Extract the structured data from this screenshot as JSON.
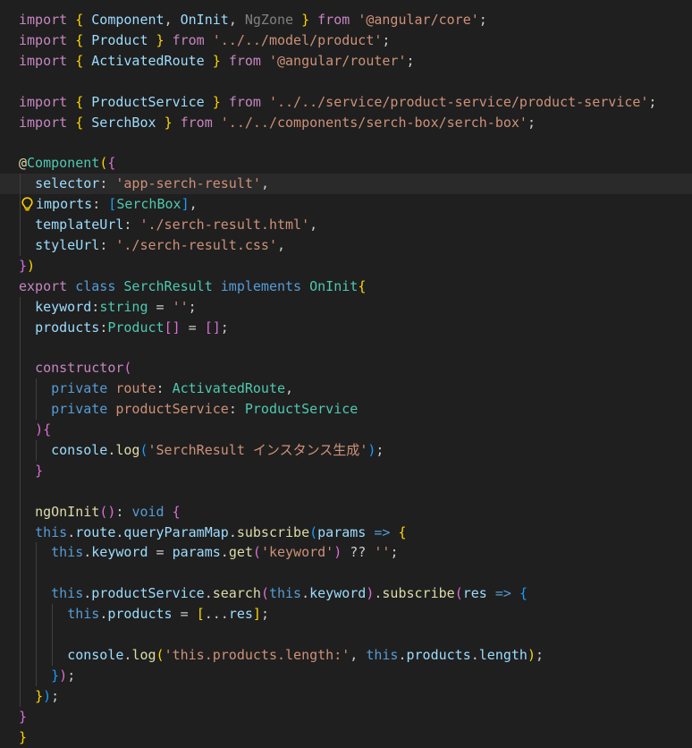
{
  "editor": {
    "lines": [
      [
        [
          "t-kw",
          "import"
        ],
        [
          "t-punc",
          " "
        ],
        [
          "t-b1",
          "{"
        ],
        [
          "t-punc",
          " "
        ],
        [
          "t-id",
          "Component"
        ],
        [
          "t-punc",
          ", "
        ],
        [
          "t-id",
          "OnInit"
        ],
        [
          "t-punc",
          ", "
        ],
        [
          "t-ngzone",
          "NgZone"
        ],
        [
          "t-punc",
          " "
        ],
        [
          "t-b1",
          "}"
        ],
        [
          "t-punc",
          " "
        ],
        [
          "t-kw",
          "from"
        ],
        [
          "t-punc",
          " "
        ],
        [
          "t-str",
          "'@angular/core'"
        ],
        [
          "t-punc",
          ";"
        ]
      ],
      [
        [
          "t-kw",
          "import"
        ],
        [
          "t-punc",
          " "
        ],
        [
          "t-b1",
          "{"
        ],
        [
          "t-punc",
          " "
        ],
        [
          "t-id",
          "Product"
        ],
        [
          "t-punc",
          " "
        ],
        [
          "t-b1",
          "}"
        ],
        [
          "t-punc",
          " "
        ],
        [
          "t-kw",
          "from"
        ],
        [
          "t-punc",
          " "
        ],
        [
          "t-str",
          "'../../model/product'"
        ],
        [
          "t-punc",
          ";"
        ]
      ],
      [
        [
          "t-kw",
          "import"
        ],
        [
          "t-punc",
          " "
        ],
        [
          "t-b1",
          "{"
        ],
        [
          "t-punc",
          " "
        ],
        [
          "t-id",
          "ActivatedRoute"
        ],
        [
          "t-punc",
          " "
        ],
        [
          "t-b1",
          "}"
        ],
        [
          "t-punc",
          " "
        ],
        [
          "t-kw",
          "from"
        ],
        [
          "t-punc",
          " "
        ],
        [
          "t-str",
          "'@angular/router'"
        ],
        [
          "t-punc",
          ";"
        ]
      ],
      [],
      [
        [
          "t-kw",
          "import"
        ],
        [
          "t-punc",
          " "
        ],
        [
          "t-b1",
          "{"
        ],
        [
          "t-punc",
          " "
        ],
        [
          "t-id",
          "ProductService"
        ],
        [
          "t-punc",
          " "
        ],
        [
          "t-b1",
          "}"
        ],
        [
          "t-punc",
          " "
        ],
        [
          "t-kw",
          "from"
        ],
        [
          "t-punc",
          " "
        ],
        [
          "t-str",
          "'../../service/product-service/product-service'"
        ],
        [
          "t-punc",
          ";"
        ]
      ],
      [
        [
          "t-kw",
          "import"
        ],
        [
          "t-punc",
          " "
        ],
        [
          "t-b1",
          "{"
        ],
        [
          "t-punc",
          " "
        ],
        [
          "t-id",
          "SerchBox"
        ],
        [
          "t-punc",
          " "
        ],
        [
          "t-b1",
          "}"
        ],
        [
          "t-punc",
          " "
        ],
        [
          "t-kw",
          "from"
        ],
        [
          "t-punc",
          " "
        ],
        [
          "t-str",
          "'../../components/serch-box/serch-box'"
        ],
        [
          "t-punc",
          ";"
        ]
      ],
      [],
      [
        [
          "t-dec",
          "@"
        ],
        [
          "t-cls",
          "Component"
        ],
        [
          "t-b1",
          "("
        ],
        [
          "t-b2",
          "{"
        ]
      ],
      [
        [
          "t-punc",
          "  "
        ],
        [
          "t-id",
          "selector"
        ],
        [
          "t-punc",
          ": "
        ],
        [
          "t-str",
          "'app-serch-result'"
        ],
        [
          "t-punc",
          ","
        ]
      ],
      [
        [
          "t-punc",
          "  "
        ],
        [
          "t-id",
          "imports"
        ],
        [
          "t-punc",
          ": "
        ],
        [
          "t-b3",
          "["
        ],
        [
          "t-cls",
          "SerchBox"
        ],
        [
          "t-b3",
          "]"
        ],
        [
          "t-punc",
          ","
        ]
      ],
      [
        [
          "t-punc",
          "  "
        ],
        [
          "t-id",
          "templateUrl"
        ],
        [
          "t-punc",
          ": "
        ],
        [
          "t-str",
          "'./serch-result.html'"
        ],
        [
          "t-punc",
          ","
        ]
      ],
      [
        [
          "t-punc",
          "  "
        ],
        [
          "t-id",
          "styleUrl"
        ],
        [
          "t-punc",
          ": "
        ],
        [
          "t-str",
          "'./serch-result.css'"
        ],
        [
          "t-punc",
          ","
        ]
      ],
      [
        [
          "t-b2",
          "}"
        ],
        [
          "t-b1",
          ")"
        ]
      ],
      [
        [
          "t-kw",
          "export"
        ],
        [
          "t-punc",
          " "
        ],
        [
          "t-blue",
          "class"
        ],
        [
          "t-punc",
          " "
        ],
        [
          "t-cls",
          "SerchResult"
        ],
        [
          "t-punc",
          " "
        ],
        [
          "t-blue",
          "implements"
        ],
        [
          "t-punc",
          " "
        ],
        [
          "t-cls",
          "OnInit"
        ],
        [
          "t-b1",
          "{"
        ]
      ],
      [
        [
          "t-punc",
          "  "
        ],
        [
          "t-id",
          "keyword"
        ],
        [
          "t-punc",
          ":"
        ],
        [
          "t-cls",
          "string"
        ],
        [
          "t-punc",
          " = "
        ],
        [
          "t-str",
          "''"
        ],
        [
          "t-punc",
          ";"
        ]
      ],
      [
        [
          "t-punc",
          "  "
        ],
        [
          "t-id",
          "products"
        ],
        [
          "t-punc",
          ":"
        ],
        [
          "t-cls",
          "Product"
        ],
        [
          "t-b2",
          "[]"
        ],
        [
          "t-punc",
          " = "
        ],
        [
          "t-b2",
          "[]"
        ],
        [
          "t-punc",
          ";"
        ]
      ],
      [],
      [
        [
          "t-punc",
          "  "
        ],
        [
          "t-kw",
          "constructor"
        ],
        [
          "t-b2",
          "("
        ]
      ],
      [
        [
          "t-punc",
          "    "
        ],
        [
          "t-blue",
          "private"
        ],
        [
          "t-punc",
          " "
        ],
        [
          "t-str",
          "route"
        ],
        [
          "t-punc",
          ": "
        ],
        [
          "t-cls",
          "ActivatedRoute"
        ],
        [
          "t-punc",
          ","
        ]
      ],
      [
        [
          "t-punc",
          "    "
        ],
        [
          "t-blue",
          "private"
        ],
        [
          "t-punc",
          " "
        ],
        [
          "t-str",
          "productService"
        ],
        [
          "t-punc",
          ": "
        ],
        [
          "t-cls",
          "ProductService"
        ]
      ],
      [
        [
          "t-punc",
          "  "
        ],
        [
          "t-b2",
          ")"
        ],
        [
          "t-b2",
          "{"
        ]
      ],
      [
        [
          "t-punc",
          "    "
        ],
        [
          "t-id",
          "console"
        ],
        [
          "t-punc",
          "."
        ],
        [
          "t-fn",
          "log"
        ],
        [
          "t-b3",
          "("
        ],
        [
          "t-str",
          "'SerchResult "
        ],
        [
          "t-str t-jp",
          "インスタンス生成"
        ],
        [
          "t-str",
          "'"
        ],
        [
          "t-b3",
          ")"
        ],
        [
          "t-punc",
          ";"
        ]
      ],
      [
        [
          "t-punc",
          "  "
        ],
        [
          "t-b2",
          "}"
        ]
      ],
      [],
      [
        [
          "t-punc",
          "  "
        ],
        [
          "t-fn",
          "ngOnInit"
        ],
        [
          "t-b2",
          "()"
        ],
        [
          "t-punc",
          ": "
        ],
        [
          "t-blue",
          "void"
        ],
        [
          "t-punc",
          " "
        ],
        [
          "t-b2",
          "{"
        ]
      ],
      [
        [
          "t-punc",
          "  "
        ],
        [
          "t-blue",
          "this"
        ],
        [
          "t-punc",
          "."
        ],
        [
          "t-id",
          "route"
        ],
        [
          "t-punc",
          "."
        ],
        [
          "t-id",
          "queryParamMap"
        ],
        [
          "t-punc",
          "."
        ],
        [
          "t-fn",
          "subscribe"
        ],
        [
          "t-b3",
          "("
        ],
        [
          "t-id",
          "params"
        ],
        [
          "t-punc",
          " "
        ],
        [
          "t-blue",
          "=>"
        ],
        [
          "t-punc",
          " "
        ],
        [
          "t-b1",
          "{"
        ]
      ],
      [
        [
          "t-punc",
          "    "
        ],
        [
          "t-blue",
          "this"
        ],
        [
          "t-punc",
          "."
        ],
        [
          "t-id",
          "keyword"
        ],
        [
          "t-punc",
          " = "
        ],
        [
          "t-id",
          "params"
        ],
        [
          "t-punc",
          "."
        ],
        [
          "t-fn",
          "get"
        ],
        [
          "t-b2",
          "("
        ],
        [
          "t-str",
          "'keyword'"
        ],
        [
          "t-b2",
          ")"
        ],
        [
          "t-punc",
          " ?? "
        ],
        [
          "t-str",
          "''"
        ],
        [
          "t-punc",
          ";"
        ]
      ],
      [],
      [
        [
          "t-punc",
          "    "
        ],
        [
          "t-blue",
          "this"
        ],
        [
          "t-punc",
          "."
        ],
        [
          "t-id",
          "productService"
        ],
        [
          "t-punc",
          "."
        ],
        [
          "t-fn",
          "search"
        ],
        [
          "t-b2",
          "("
        ],
        [
          "t-blue",
          "this"
        ],
        [
          "t-punc",
          "."
        ],
        [
          "t-id",
          "keyword"
        ],
        [
          "t-b2",
          ")"
        ],
        [
          "t-punc",
          "."
        ],
        [
          "t-fn",
          "subscribe"
        ],
        [
          "t-b2",
          "("
        ],
        [
          "t-id",
          "res"
        ],
        [
          "t-punc",
          " "
        ],
        [
          "t-blue",
          "=>"
        ],
        [
          "t-punc",
          " "
        ],
        [
          "t-b3",
          "{"
        ]
      ],
      [
        [
          "t-punc",
          "      "
        ],
        [
          "t-blue",
          "this"
        ],
        [
          "t-punc",
          "."
        ],
        [
          "t-id",
          "products"
        ],
        [
          "t-punc",
          " = "
        ],
        [
          "t-b1",
          "["
        ],
        [
          "t-punc",
          "..."
        ],
        [
          "t-id",
          "res"
        ],
        [
          "t-b1",
          "]"
        ],
        [
          "t-punc",
          ";"
        ]
      ],
      [],
      [
        [
          "t-punc",
          "      "
        ],
        [
          "t-id",
          "console"
        ],
        [
          "t-punc",
          "."
        ],
        [
          "t-fn",
          "log"
        ],
        [
          "t-b1",
          "("
        ],
        [
          "t-str",
          "'this.products.length:'"
        ],
        [
          "t-punc",
          ", "
        ],
        [
          "t-blue",
          "this"
        ],
        [
          "t-punc",
          "."
        ],
        [
          "t-id",
          "products"
        ],
        [
          "t-punc",
          "."
        ],
        [
          "t-id",
          "length"
        ],
        [
          "t-b1",
          ")"
        ],
        [
          "t-punc",
          ";"
        ]
      ],
      [
        [
          "t-punc",
          "    "
        ],
        [
          "t-b3",
          "}"
        ],
        [
          "t-b2",
          ")"
        ],
        [
          "t-punc",
          ";"
        ]
      ],
      [
        [
          "t-punc",
          "  "
        ],
        [
          "t-b1",
          "}"
        ],
        [
          "t-b3",
          ")"
        ],
        [
          "t-punc",
          ";"
        ]
      ],
      [
        [
          "t-b2",
          "}"
        ]
      ],
      [
        [
          "t-b1",
          "}"
        ]
      ]
    ]
  },
  "icons": {
    "lightbulb": "lightbulb-icon"
  },
  "colors": {
    "background": "#1f1f1f",
    "keyword": "#c586c0",
    "identifier": "#9cdcfe",
    "type": "#4ec9b0",
    "string": "#ce9178",
    "function": "#dcdcaa",
    "storage": "#569cd6",
    "bracket_gold": "#ffd700",
    "bracket_orchid": "#da70d6",
    "bracket_blue": "#179fff"
  }
}
